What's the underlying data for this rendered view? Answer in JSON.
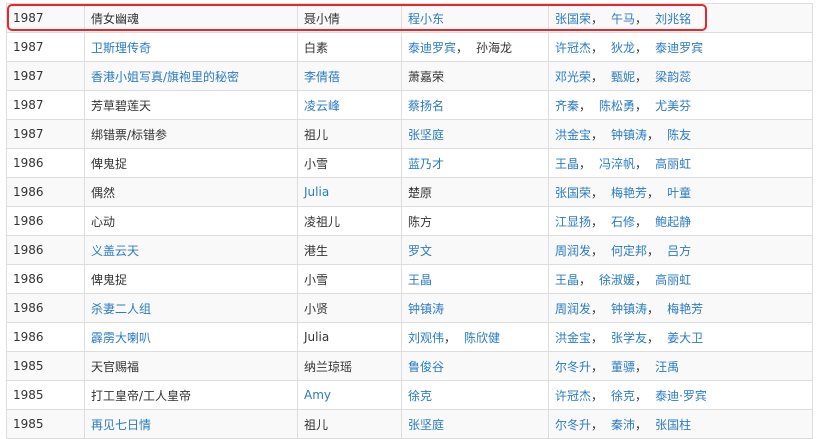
{
  "highlight_color": "#e8262c",
  "link_color": "#2a7bc2",
  "rows": [
    {
      "year": "1987",
      "title": {
        "text": "倩女幽魂",
        "link": false
      },
      "role": {
        "text": "聂小倩",
        "link": false
      },
      "director": [
        {
          "text": "程小东",
          "link": true
        }
      ],
      "cast": [
        {
          "text": "张国荣",
          "link": true
        },
        {
          "text": "午马",
          "link": true
        },
        {
          "text": "刘兆铭",
          "link": true
        }
      ]
    },
    {
      "year": "1987",
      "title": {
        "text": "卫斯理传奇",
        "link": true
      },
      "role": {
        "text": "白素",
        "link": false
      },
      "director": [
        {
          "text": "泰迪罗宾",
          "link": true
        },
        {
          "text": "孙海龙",
          "link": false
        }
      ],
      "cast": [
        {
          "text": "许冠杰",
          "link": true
        },
        {
          "text": "狄龙",
          "link": true
        },
        {
          "text": "泰迪罗宾",
          "link": true
        }
      ]
    },
    {
      "year": "1987",
      "title": {
        "text": "香港小姐写真/旗袍里的秘密",
        "link": true
      },
      "role": {
        "text": "李倩蓓",
        "link": true
      },
      "director": [
        {
          "text": "萧嘉荣",
          "link": false
        }
      ],
      "cast": [
        {
          "text": "邓光荣",
          "link": true
        },
        {
          "text": "甄妮",
          "link": true
        },
        {
          "text": "梁韵蕊",
          "link": true
        }
      ]
    },
    {
      "year": "1987",
      "title": {
        "text": "芳草碧莲天",
        "link": false
      },
      "role": {
        "text": "凌云峰",
        "link": true
      },
      "director": [
        {
          "text": "蔡扬名",
          "link": true
        }
      ],
      "cast": [
        {
          "text": "齐秦",
          "link": true
        },
        {
          "text": "陈松勇",
          "link": true
        },
        {
          "text": "尤美芬",
          "link": true
        }
      ]
    },
    {
      "year": "1987",
      "title": {
        "text": "绑错票/标错参",
        "link": false
      },
      "role": {
        "text": "祖儿",
        "link": false
      },
      "director": [
        {
          "text": "张坚庭",
          "link": true
        }
      ],
      "cast": [
        {
          "text": "洪金宝",
          "link": true
        },
        {
          "text": "钟镇涛",
          "link": true
        },
        {
          "text": "陈友",
          "link": true
        }
      ]
    },
    {
      "year": "1986",
      "title": {
        "text": "俾鬼捉",
        "link": false
      },
      "role": {
        "text": "小雪",
        "link": false
      },
      "director": [
        {
          "text": "蓝乃才",
          "link": true
        }
      ],
      "cast": [
        {
          "text": "王晶",
          "link": true
        },
        {
          "text": "冯淬帆",
          "link": true
        },
        {
          "text": "高丽虹",
          "link": true
        }
      ]
    },
    {
      "year": "1986",
      "title": {
        "text": "偶然",
        "link": false
      },
      "role": {
        "text": "Julia",
        "link": true
      },
      "director": [
        {
          "text": "楚原",
          "link": false
        }
      ],
      "cast": [
        {
          "text": "张国荣",
          "link": true
        },
        {
          "text": "梅艳芳",
          "link": true
        },
        {
          "text": "叶童",
          "link": true
        }
      ]
    },
    {
      "year": "1986",
      "title": {
        "text": "心动",
        "link": false
      },
      "role": {
        "text": "凌祖儿",
        "link": false
      },
      "director": [
        {
          "text": "陈方",
          "link": false
        }
      ],
      "cast": [
        {
          "text": "江显扬",
          "link": true
        },
        {
          "text": "石修",
          "link": true
        },
        {
          "text": "鲍起静",
          "link": true
        }
      ]
    },
    {
      "year": "1986",
      "title": {
        "text": "义盖云天",
        "link": true
      },
      "role": {
        "text": "港生",
        "link": false
      },
      "director": [
        {
          "text": "罗文",
          "link": true
        }
      ],
      "cast": [
        {
          "text": "周润发",
          "link": true
        },
        {
          "text": "何定邦",
          "link": true
        },
        {
          "text": "吕方",
          "link": true
        }
      ]
    },
    {
      "year": "1986",
      "title": {
        "text": "俾鬼捉",
        "link": false
      },
      "role": {
        "text": "小雪",
        "link": false
      },
      "director": [
        {
          "text": "王晶",
          "link": true
        }
      ],
      "cast": [
        {
          "text": "王晶",
          "link": true
        },
        {
          "text": "徐淑媛",
          "link": true
        },
        {
          "text": "高丽虹",
          "link": true
        }
      ]
    },
    {
      "year": "1986",
      "title": {
        "text": "杀妻二人组",
        "link": true
      },
      "role": {
        "text": "小贤",
        "link": false
      },
      "director": [
        {
          "text": "钟镇涛",
          "link": true
        }
      ],
      "cast": [
        {
          "text": "周润发",
          "link": true
        },
        {
          "text": "钟镇涛",
          "link": true
        },
        {
          "text": "梅艳芳",
          "link": true
        }
      ]
    },
    {
      "year": "1986",
      "title": {
        "text": "霹雳大喇叭",
        "link": true
      },
      "role": {
        "text": "Julia",
        "link": false
      },
      "director": [
        {
          "text": "刘观伟",
          "link": true
        },
        {
          "text": "陈欣健",
          "link": true
        }
      ],
      "cast": [
        {
          "text": "洪金宝",
          "link": true
        },
        {
          "text": "张学友",
          "link": true
        },
        {
          "text": "姜大卫",
          "link": true
        }
      ]
    },
    {
      "year": "1985",
      "title": {
        "text": "天官赐福",
        "link": false
      },
      "role": {
        "text": "纳兰琼瑶",
        "link": false
      },
      "director": [
        {
          "text": "鲁俊谷",
          "link": true
        }
      ],
      "cast": [
        {
          "text": "尔冬升",
          "link": true
        },
        {
          "text": "董骠",
          "link": true
        },
        {
          "text": "汪禹",
          "link": true
        }
      ]
    },
    {
      "year": "1985",
      "title": {
        "text": "打工皇帝/工人皇帝",
        "link": false
      },
      "role": {
        "text": "Amy",
        "link": true
      },
      "director": [
        {
          "text": "徐克",
          "link": true
        }
      ],
      "cast": [
        {
          "text": "许冠杰",
          "link": true
        },
        {
          "text": "徐克",
          "link": true
        },
        {
          "text": "泰迪·罗宾",
          "link": true
        }
      ]
    },
    {
      "year": "1985",
      "title": {
        "text": "再见七日情",
        "link": true
      },
      "role": {
        "text": "祖儿",
        "link": false
      },
      "director": [
        {
          "text": "张坚庭",
          "link": true
        }
      ],
      "cast": [
        {
          "text": "尔冬升",
          "link": true
        },
        {
          "text": "秦沛",
          "link": true
        },
        {
          "text": "张国柱",
          "link": true
        }
      ]
    }
  ]
}
